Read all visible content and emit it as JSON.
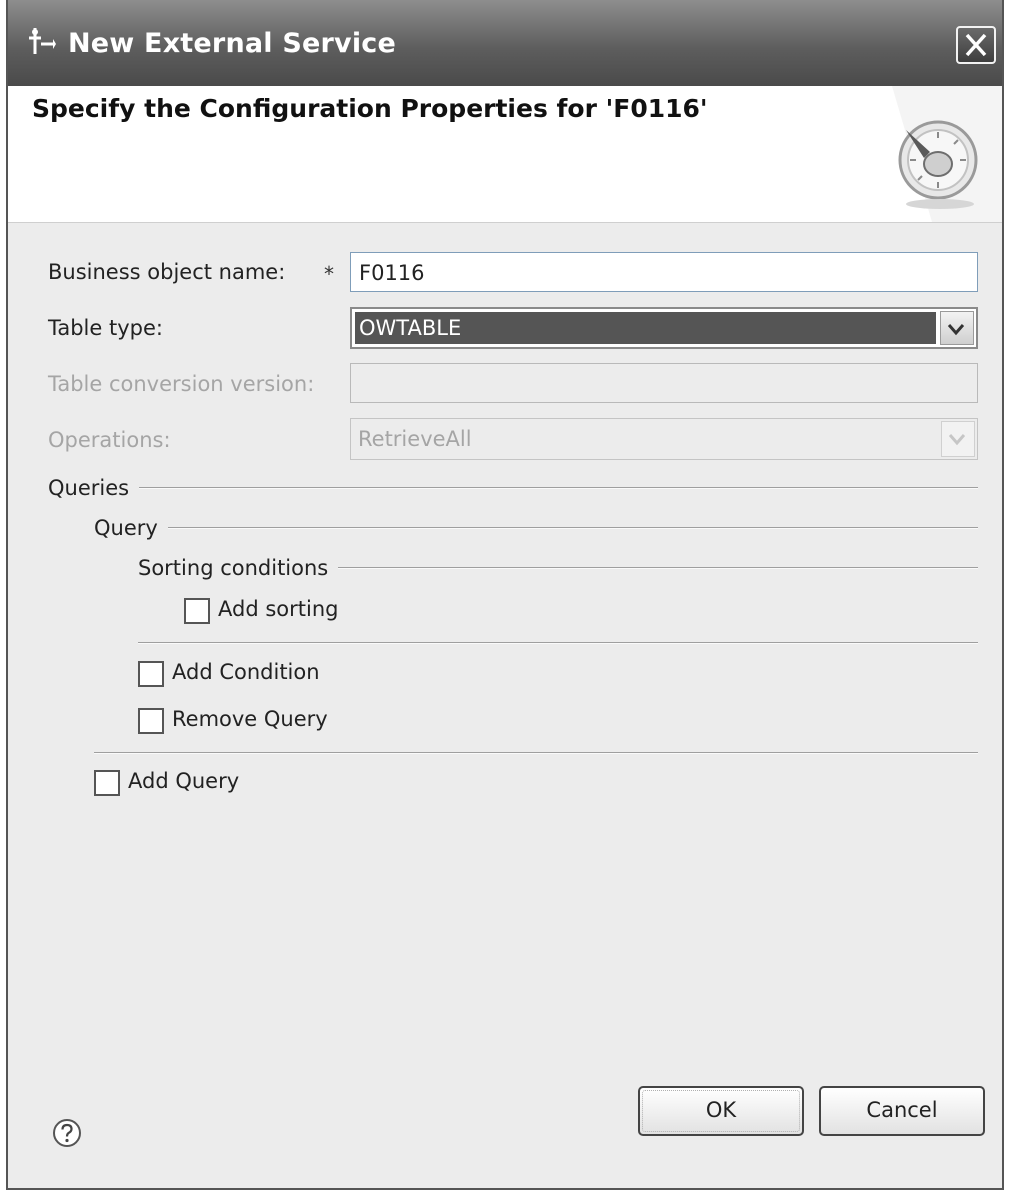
{
  "window": {
    "title": "New External Service",
    "close_icon": "close-icon"
  },
  "header": {
    "title": "Specify the Configuration Properties for 'F0116'",
    "banner_icon": "wizard-gauge-icon"
  },
  "form": {
    "business_object_name": {
      "label": "Business object name:",
      "required_mark": "*",
      "value": "F0116"
    },
    "table_type": {
      "label": "Table type:",
      "value": "OWTABLE"
    },
    "table_conversion_version": {
      "label": "Table conversion version:",
      "value": ""
    },
    "operations": {
      "label": "Operations:",
      "value": "RetrieveAll"
    }
  },
  "queries": {
    "label": "Queries",
    "query": {
      "label": "Query",
      "sorting": {
        "label": "Sorting conditions",
        "add_sorting": "Add sorting"
      },
      "add_condition": "Add Condition",
      "remove_query": "Remove Query"
    },
    "add_query": "Add Query"
  },
  "footer": {
    "help_icon": "help-icon",
    "ok_label": "OK",
    "cancel_label": "Cancel"
  }
}
